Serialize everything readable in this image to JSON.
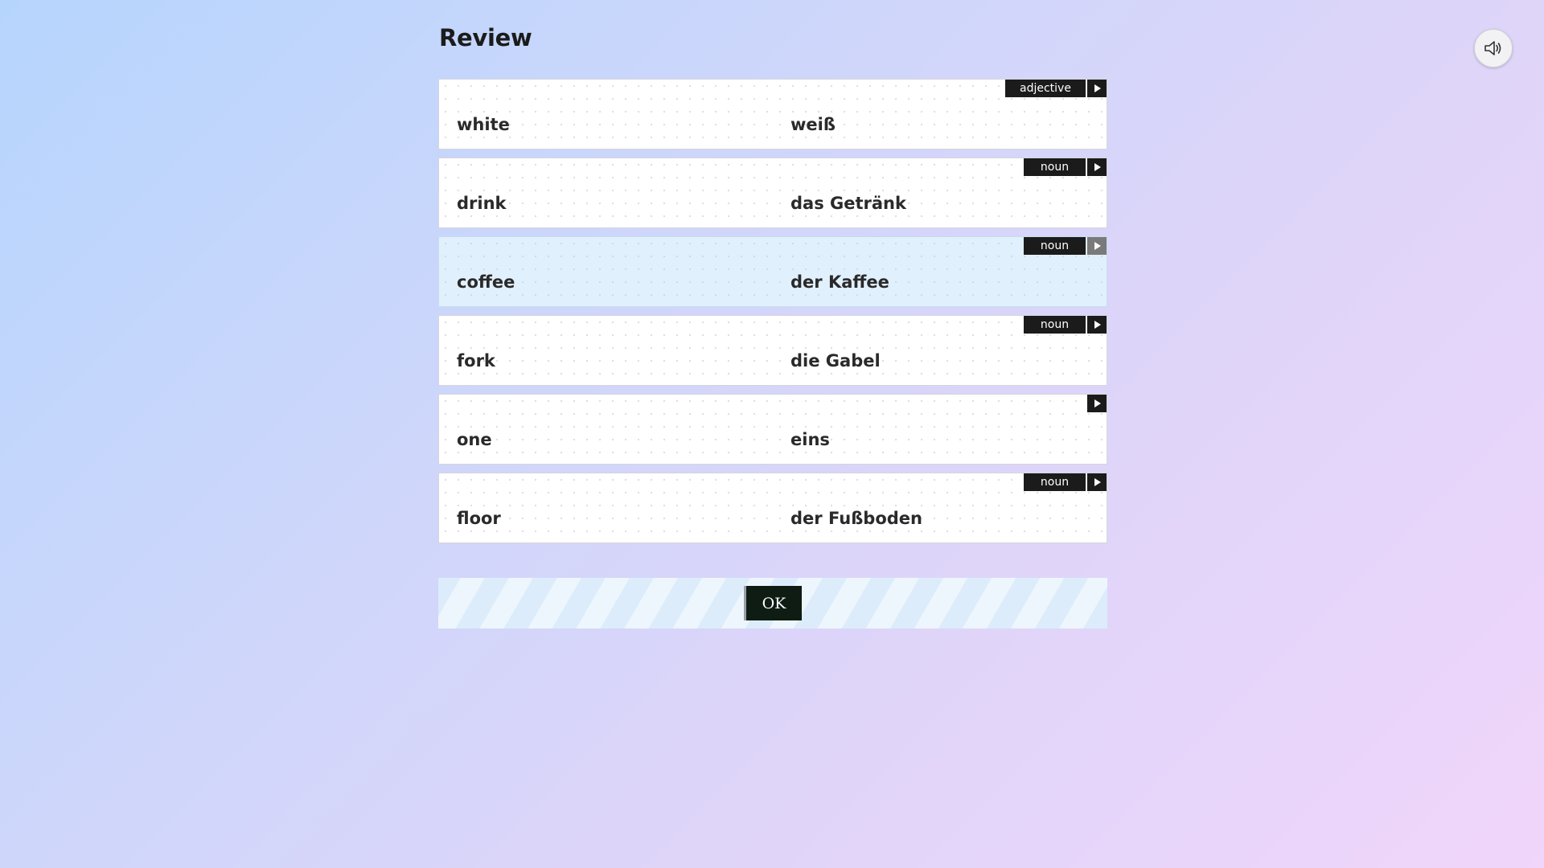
{
  "header": {
    "title": "Review"
  },
  "audio": {
    "icon": "speaker-icon"
  },
  "cards": [
    {
      "term": "white",
      "translation": "weiß",
      "pos": "adjective",
      "play_icon": "play-icon",
      "active": false
    },
    {
      "term": "drink",
      "translation": "das Getränk",
      "pos": "noun",
      "play_icon": "play-icon",
      "active": false
    },
    {
      "term": "coffee",
      "translation": "der Kaffee",
      "pos": "noun",
      "play_icon": "play-icon",
      "active": true
    },
    {
      "term": "fork",
      "translation": "die Gabel",
      "pos": "noun",
      "play_icon": "play-icon",
      "active": false
    },
    {
      "term": "one",
      "translation": "eins",
      "pos": "",
      "play_icon": "play-icon",
      "active": false
    },
    {
      "term": "floor",
      "translation": "der Fußboden",
      "pos": "noun",
      "play_icon": "play-icon",
      "active": false
    }
  ],
  "footer": {
    "ok_label": "OK"
  },
  "colors": {
    "tag_background": "#1b1b1b",
    "active_card": "#e1f0fd",
    "ok_button": "#0e1c14"
  }
}
